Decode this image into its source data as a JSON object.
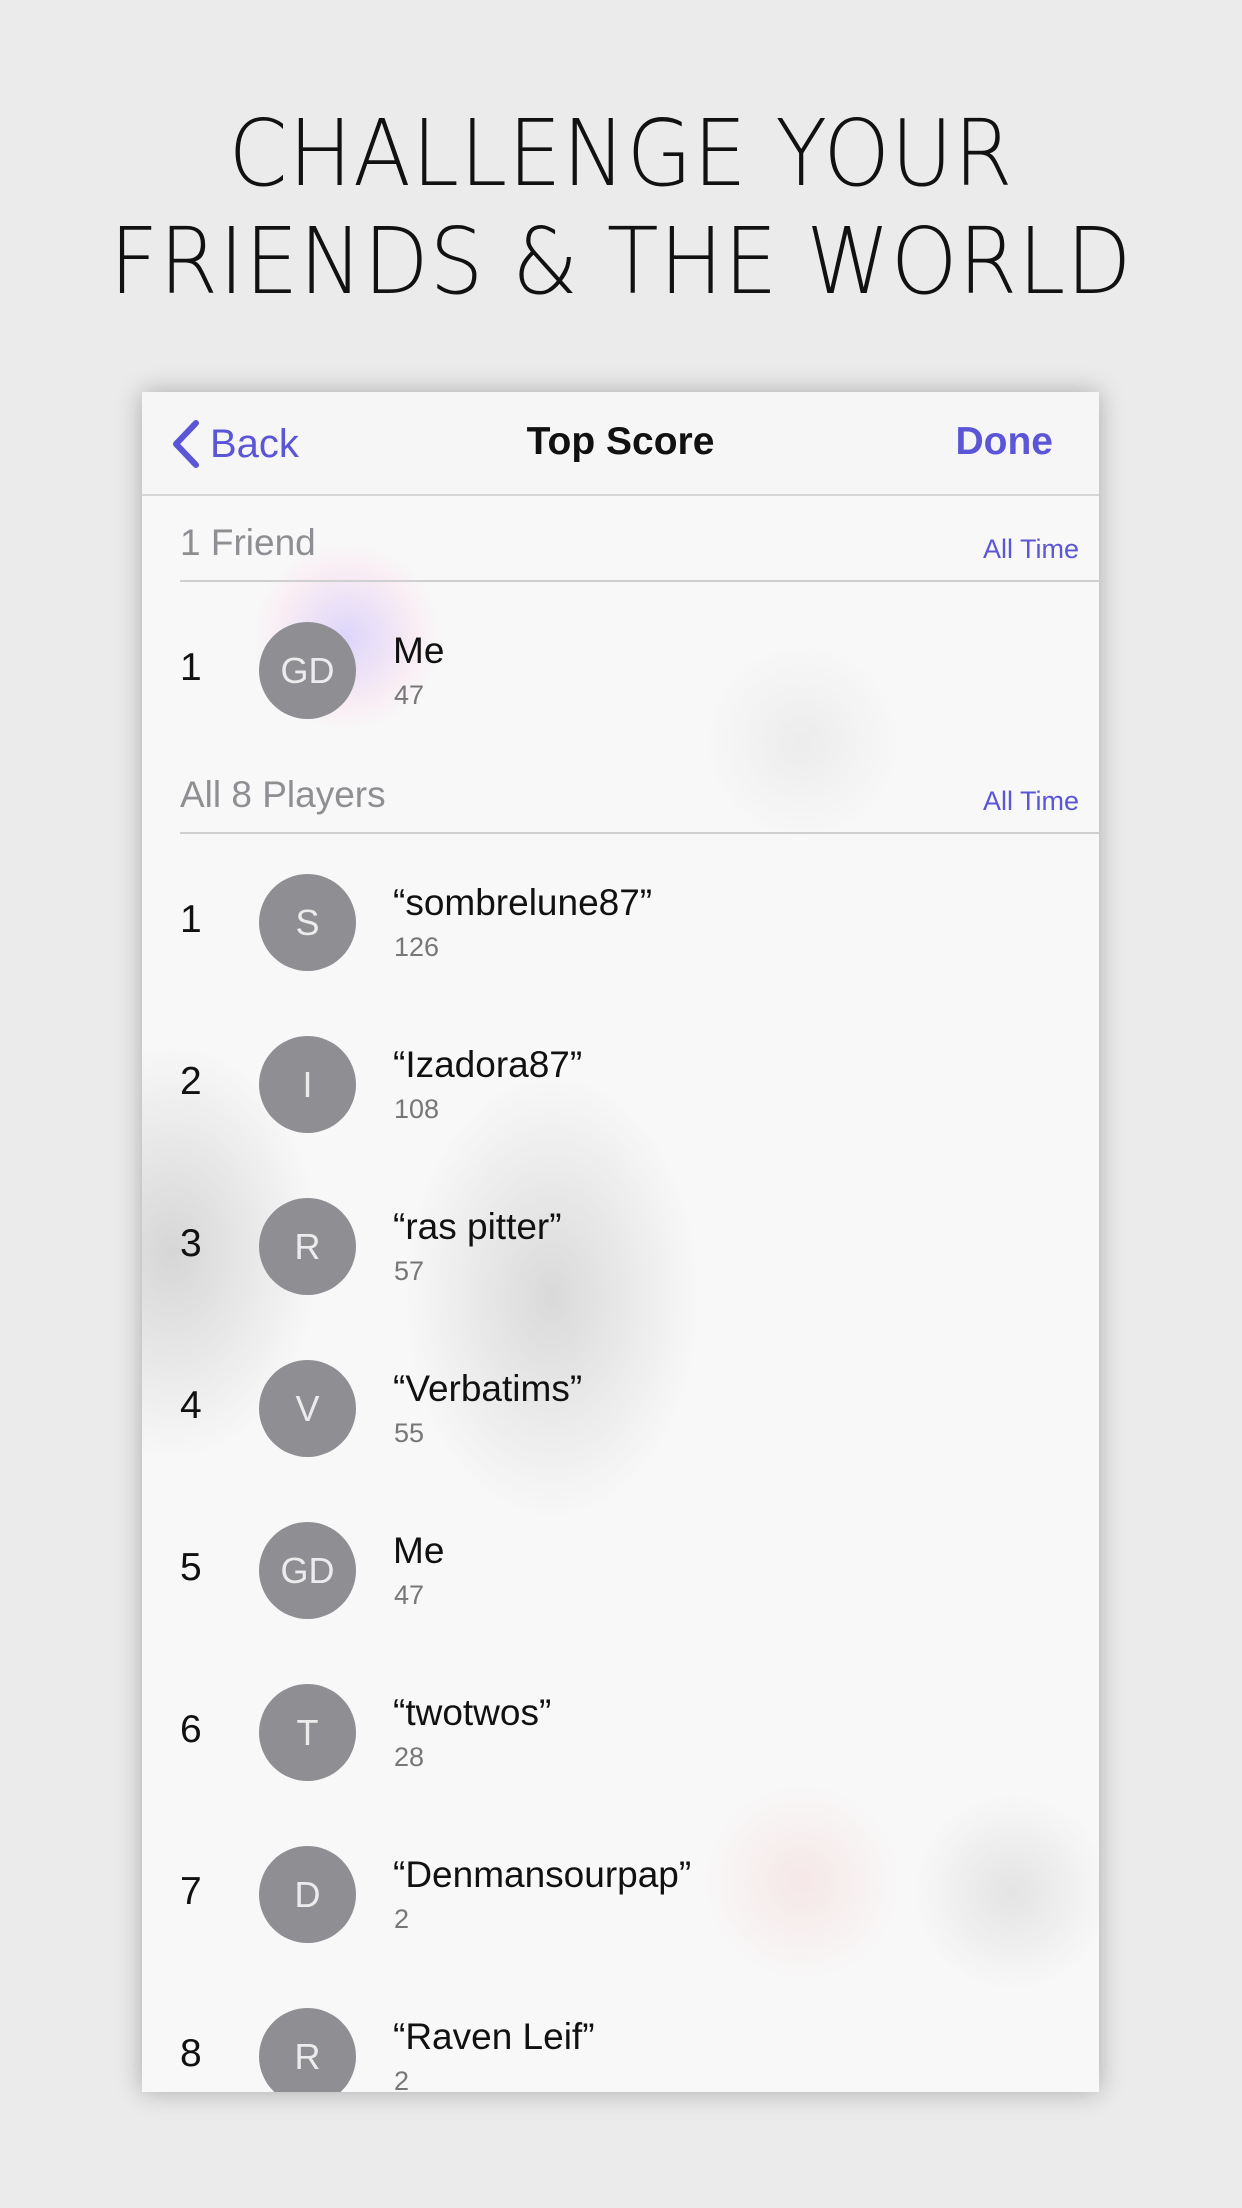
{
  "headline": {
    "line1": "CHALLENGE YOUR",
    "line2": "FRIENDS & THE WORLD"
  },
  "nav": {
    "back_label": "Back",
    "title": "Top Score",
    "done_label": "Done"
  },
  "friends_section": {
    "title": "1 Friend",
    "filter": "All Time",
    "rows": [
      {
        "rank": "1",
        "initials": "GD",
        "name": "Me",
        "score": "47"
      }
    ]
  },
  "all_section": {
    "title": "All 8 Players",
    "filter": "All Time",
    "rows": [
      {
        "rank": "1",
        "initials": "S",
        "name": "“sombrelune87”",
        "score": "126"
      },
      {
        "rank": "2",
        "initials": "I",
        "name": "“Izadora87”",
        "score": "108"
      },
      {
        "rank": "3",
        "initials": "R",
        "name": "“ras pitter”",
        "score": "57"
      },
      {
        "rank": "4",
        "initials": "V",
        "name": "“Verbatims”",
        "score": "55"
      },
      {
        "rank": "5",
        "initials": "GD",
        "name": "Me",
        "score": "47"
      },
      {
        "rank": "6",
        "initials": "T",
        "name": "“twotwos”",
        "score": "28"
      },
      {
        "rank": "7",
        "initials": "D",
        "name": "“Denmansourpap”",
        "score": "2"
      },
      {
        "rank": "8",
        "initials": "R",
        "name": "“Raven Leif”",
        "score": "2"
      }
    ]
  },
  "colors": {
    "accent": "#5b56d6",
    "avatar": "#8e8e93",
    "background": "#ebebeb",
    "panel": "#f8f8f8"
  }
}
